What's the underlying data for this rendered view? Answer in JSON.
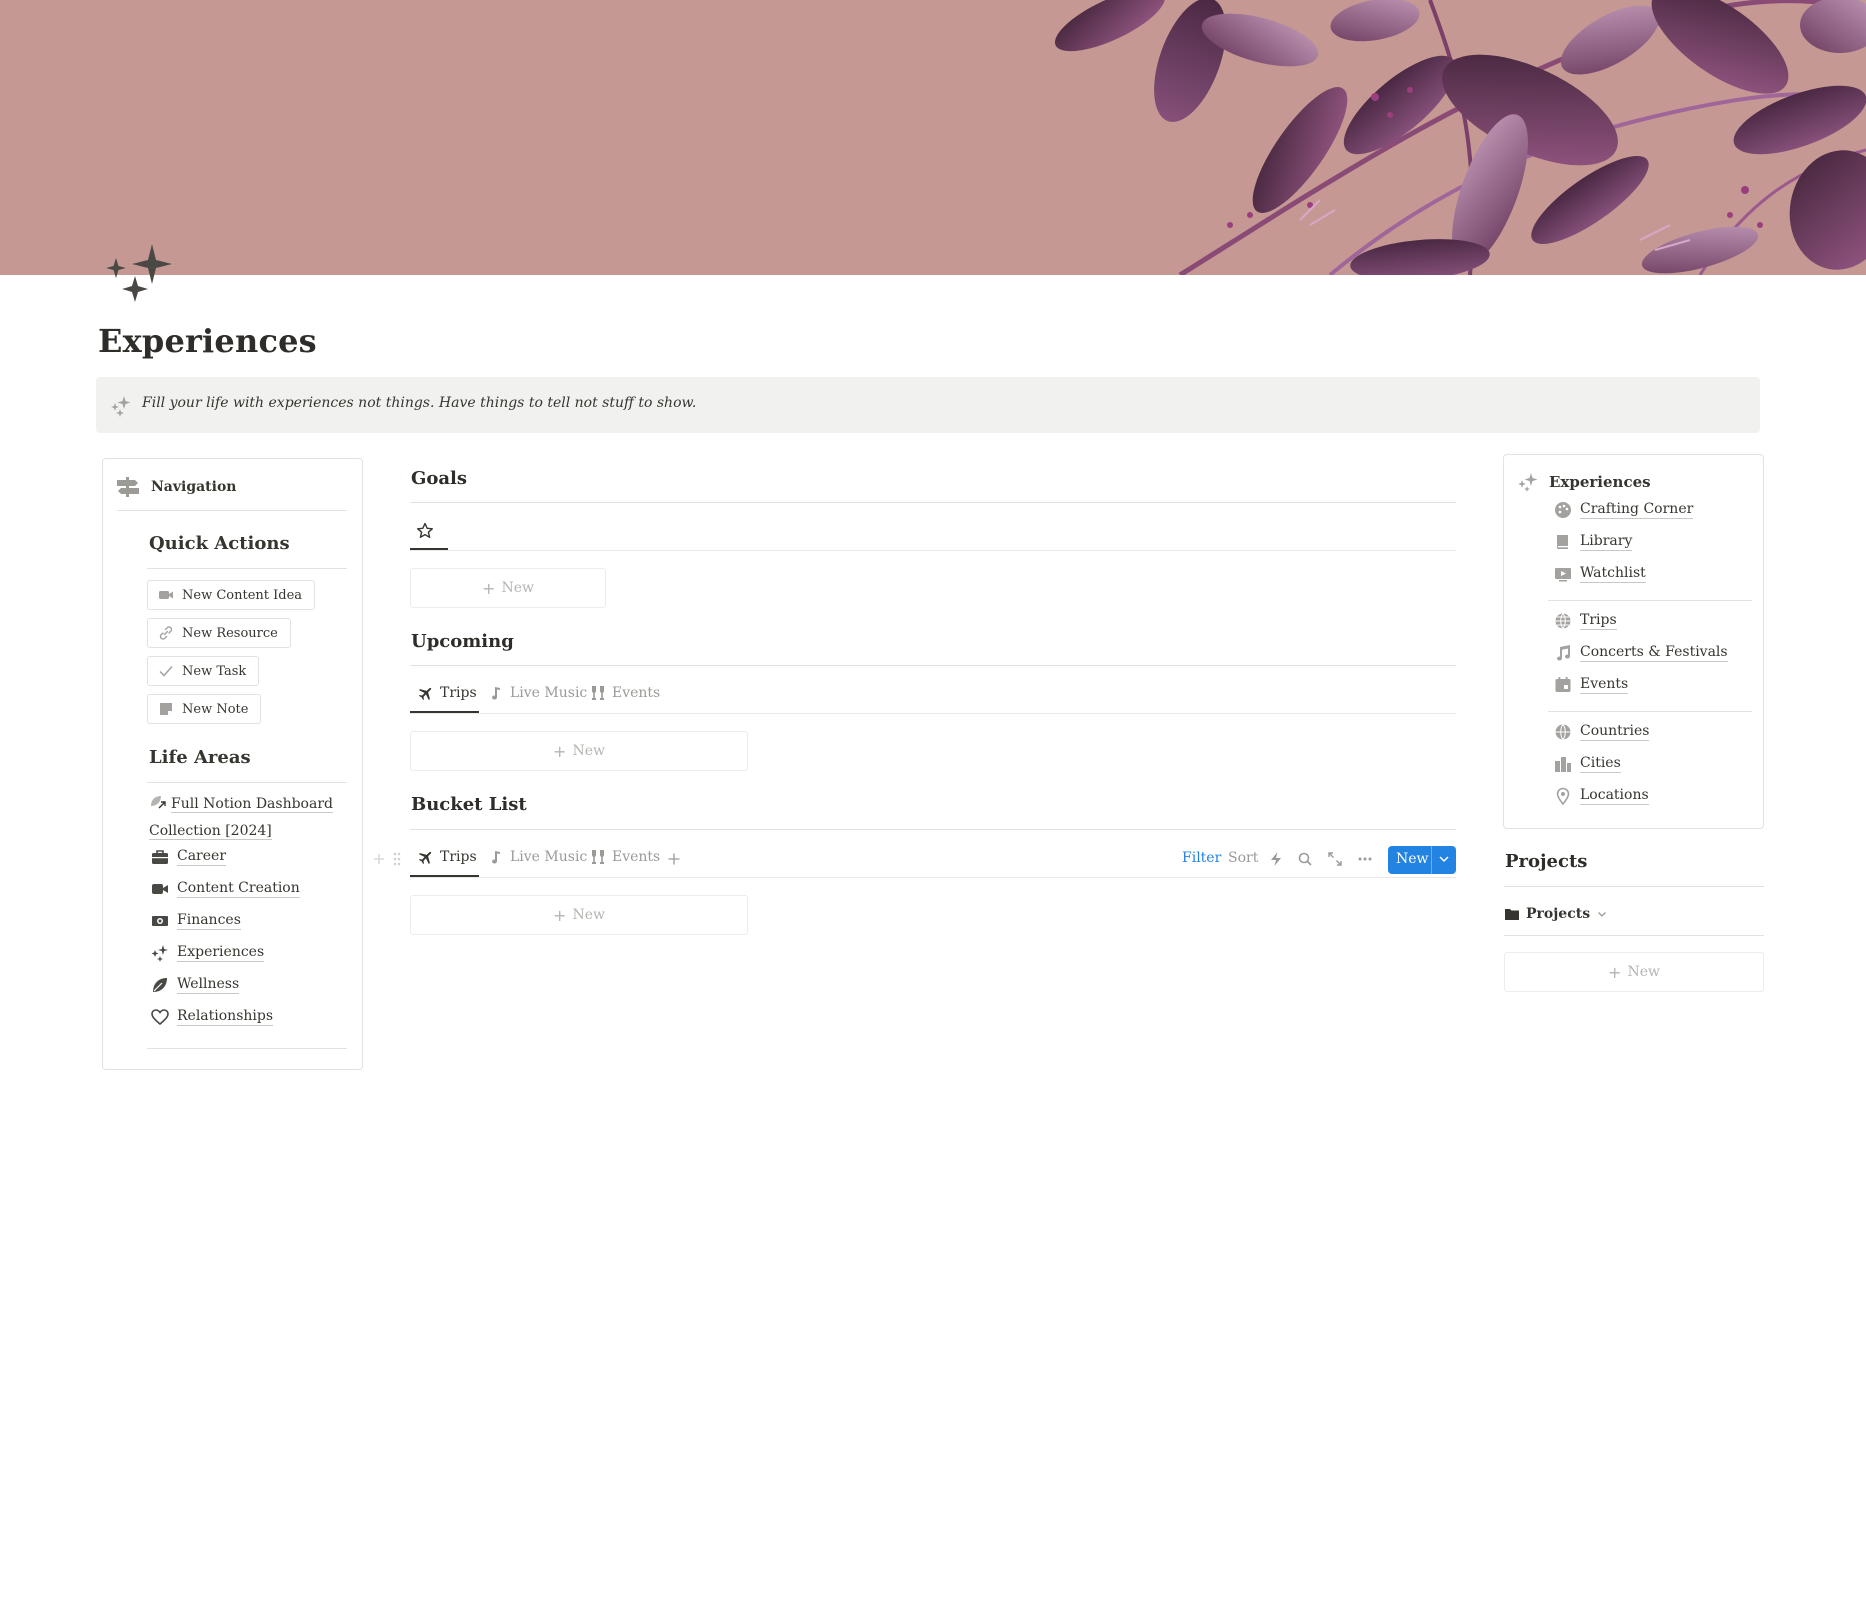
{
  "page": {
    "title": "Experiences",
    "callout": "Fill your life with experiences not things. Have things to tell not stuff to show."
  },
  "navigation": {
    "header": "Navigation",
    "quick_actions": {
      "title": "Quick Actions",
      "buttons": [
        "New Content Idea",
        "New Resource",
        "New Task",
        "New Note"
      ]
    },
    "life_areas": {
      "title": "Life Areas",
      "full_dashboard_label": "Full Notion Dashboard Collection [2024]",
      "items": [
        "Career",
        "Content Creation",
        "Finances",
        "Experiences",
        "Wellness",
        "Relationships"
      ]
    }
  },
  "main": {
    "goals": {
      "title": "Goals",
      "new_label": "New"
    },
    "upcoming": {
      "title": "Upcoming",
      "tabs": [
        "Trips",
        "Live Music",
        "Events"
      ],
      "new_label": "New"
    },
    "bucket_list": {
      "title": "Bucket List",
      "tabs": [
        "Trips",
        "Live Music",
        "Events"
      ],
      "toolbar": {
        "filter": "Filter",
        "sort": "Sort",
        "new": "New"
      },
      "new_label": "New"
    }
  },
  "right_panel": {
    "header": "Experiences",
    "group1": [
      "Crafting Corner",
      "Library",
      "Watchlist"
    ],
    "group2": [
      "Trips",
      "Concerts & Festivals",
      "Events"
    ],
    "group3": [
      "Countries",
      "Cities",
      "Locations"
    ]
  },
  "projects": {
    "title": "Projects",
    "view_label": "Projects",
    "new_label": "New"
  },
  "colors": {
    "cover_bg": "#c59893",
    "leaf_dark": "#5e3050",
    "leaf_mid": "#8a4a76",
    "leaf_light": "#b27aa3",
    "accent_blue": "#2383e2",
    "text": "#37352f",
    "muted": "#9b9a97"
  }
}
